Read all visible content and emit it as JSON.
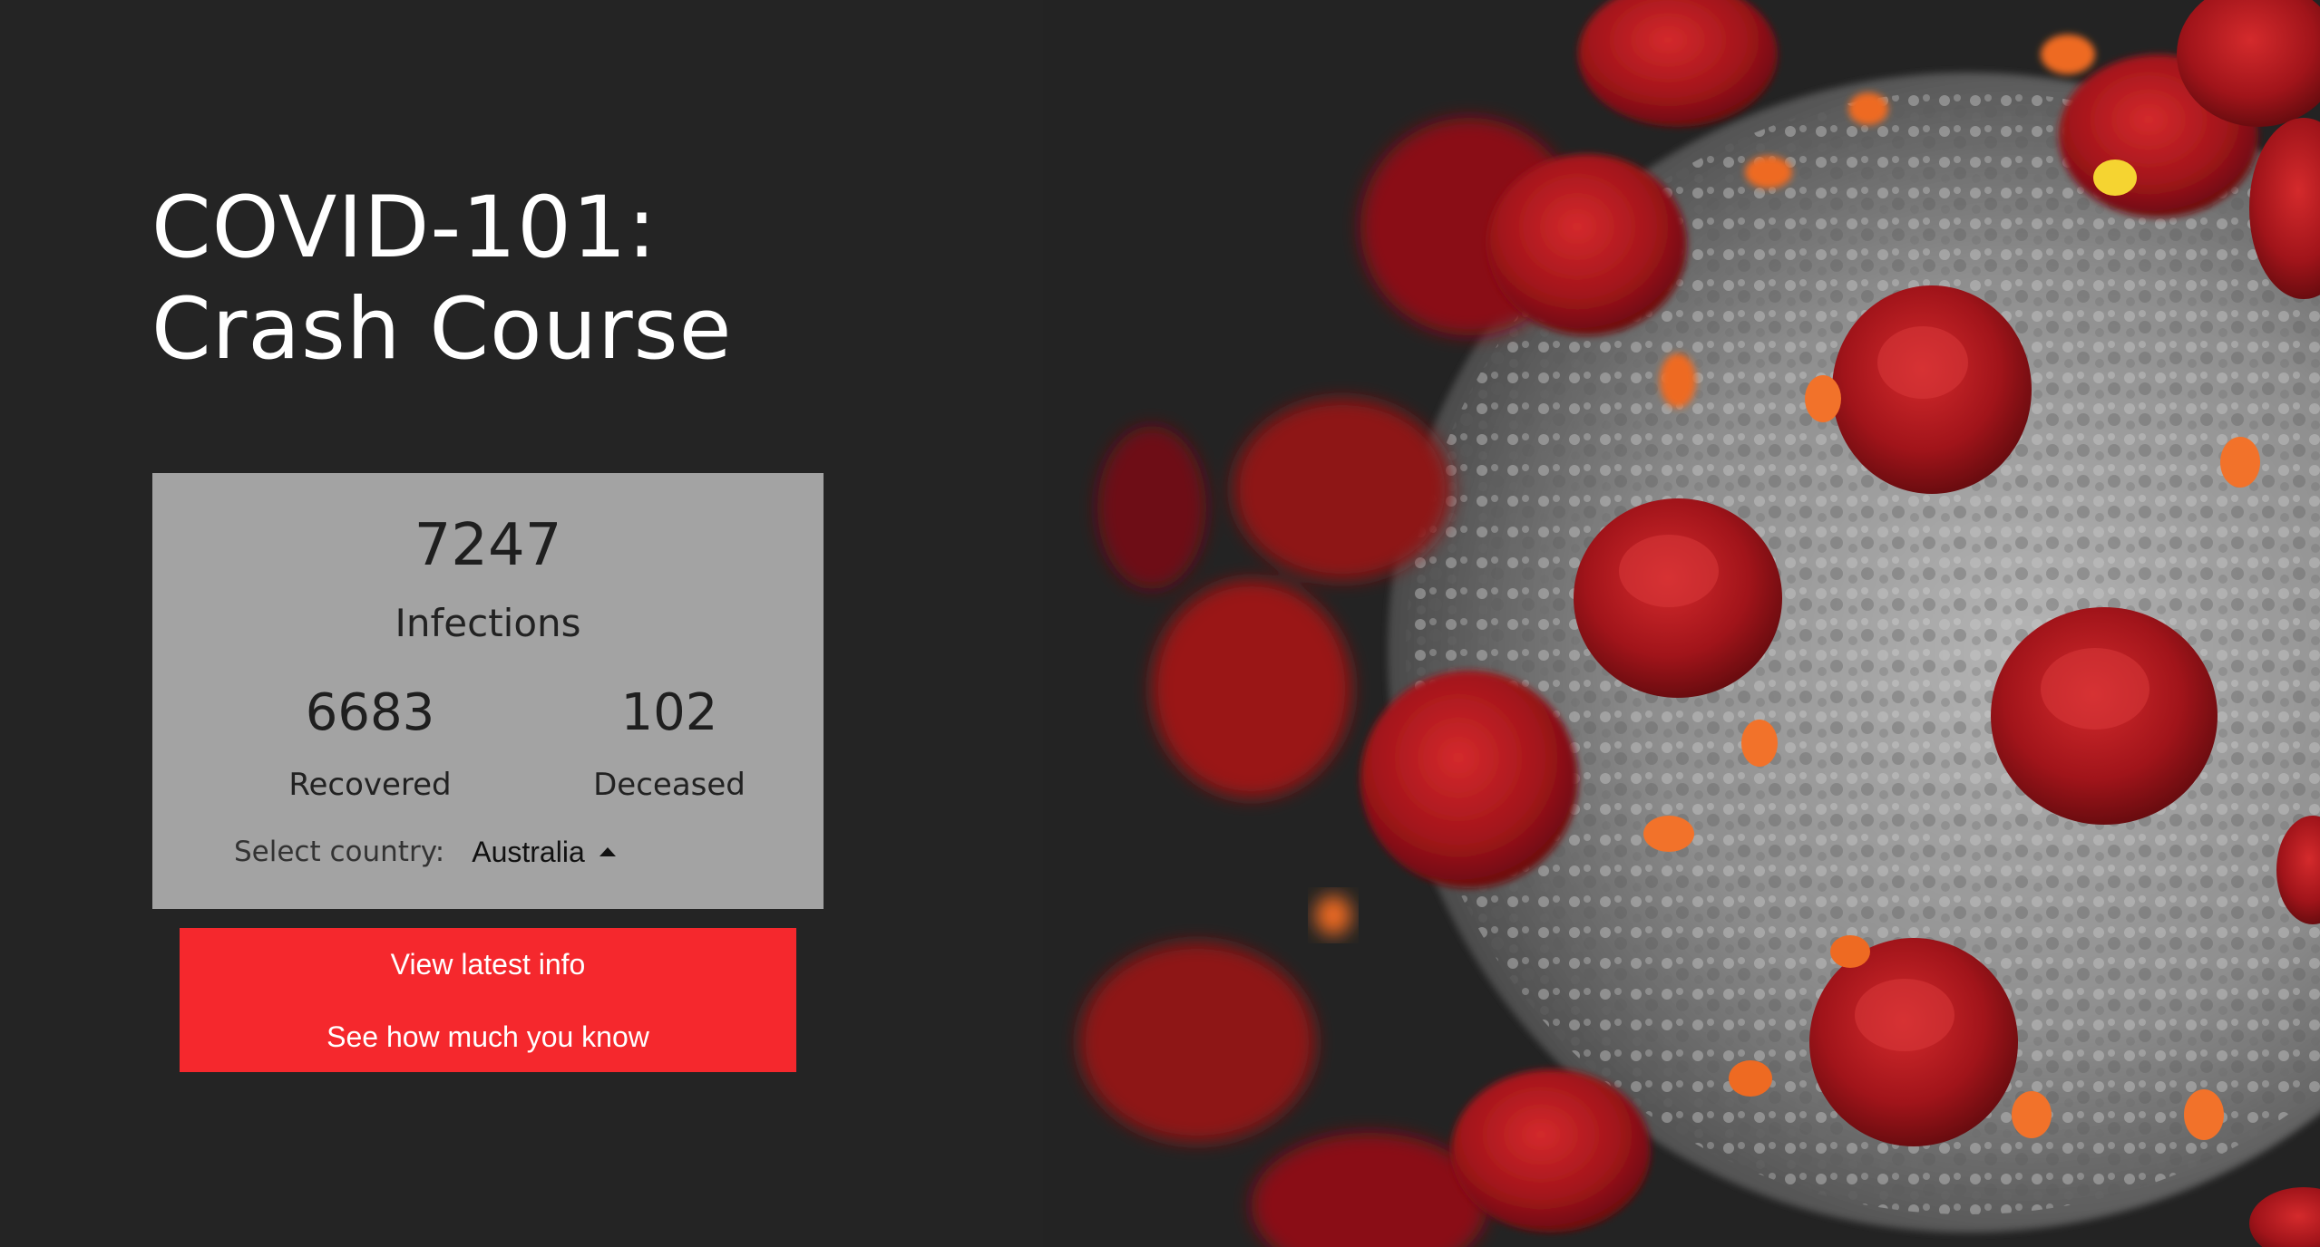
{
  "hero": {
    "title_line1": "COVID-101:",
    "title_line2": "Crash Course",
    "image": "coronavirus-illustration"
  },
  "stats": {
    "infections_value": "7247",
    "infections_label": "Infections",
    "recovered_value": "6683",
    "recovered_label": "Recovered",
    "deceased_value": "102",
    "deceased_label": "Deceased",
    "select_label": "Select country:",
    "selected_country": "Australia"
  },
  "actions": {
    "latest_info": "View latest info",
    "quiz": "See how much you know"
  },
  "colors": {
    "background": "#242424",
    "card": "#a3a3a3",
    "accent": "#f5282d",
    "spike": "#a81418",
    "virus_body": "#8c8c8c",
    "orange_dots": "#f2722a",
    "yellow_dot": "#f5d431"
  },
  "icons": {
    "country_dropdown": "caret-up-icon"
  }
}
